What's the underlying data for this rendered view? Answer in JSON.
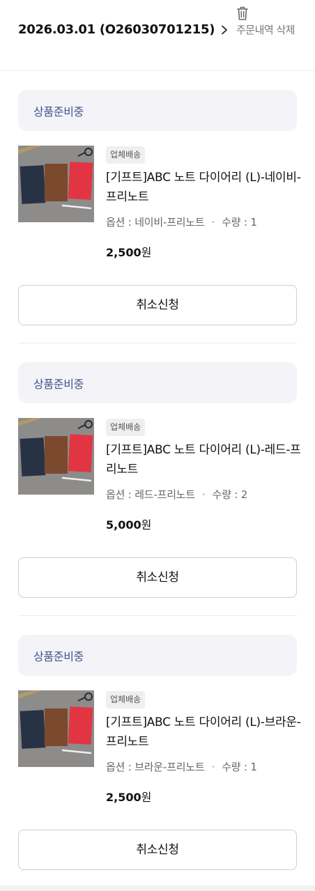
{
  "header": {
    "order_title": "2026.03.01 (O26030701215)",
    "delete_label": "주문내역 삭제"
  },
  "colors": {
    "status_text": "#46508f",
    "status_bg": "#f4f4f8",
    "badge_bg": "#efefef"
  },
  "icons": {
    "chevron": "chevron-right-icon",
    "trash": "trash-icon"
  },
  "orders": [
    {
      "status": "상품준비중",
      "badge": "업체배송",
      "product_name": "[기프트]ABC 노트 다이어리 (L)-네이비-프리노트",
      "option": "옵션 : 네이비-프리노트",
      "quantity": "수량 : 1",
      "price_amount": "2,500",
      "price_unit": "원",
      "cancel_label": "취소신청"
    },
    {
      "status": "상품준비중",
      "badge": "업체배송",
      "product_name": "[기프트]ABC 노트 다이어리 (L)-레드-프리노트",
      "option": "옵션 : 레드-프리노트",
      "quantity": "수량 : 2",
      "price_amount": "5,000",
      "price_unit": "원",
      "cancel_label": "취소신청"
    },
    {
      "status": "상품준비중",
      "badge": "업체배송",
      "product_name": "[기프트]ABC 노트 다이어리 (L)-브라운-프리노트",
      "option": "옵션 : 브라운-프리노트",
      "quantity": "수량 : 1",
      "price_amount": "2,500",
      "price_unit": "원",
      "cancel_label": "취소신청"
    }
  ]
}
